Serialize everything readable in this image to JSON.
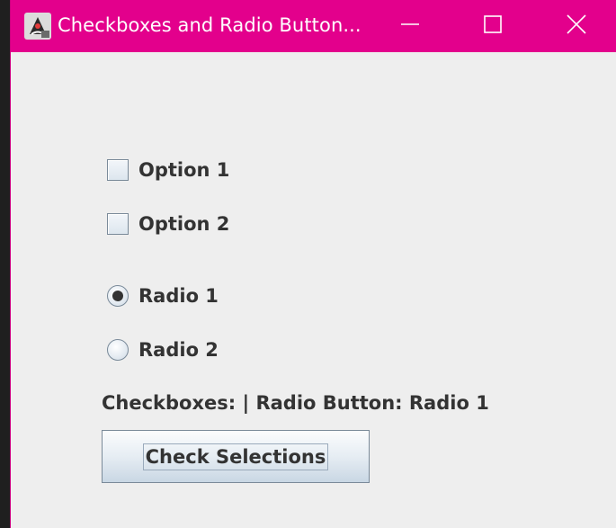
{
  "window": {
    "title": "Checkboxes and Radio Button...",
    "titlebar_color": "#e3008c",
    "app_icon": "java-duke-icon",
    "controls": {
      "minimize_icon": "minimize-icon",
      "maximize_icon": "maximize-icon",
      "close_icon": "close-icon"
    }
  },
  "checkboxes": [
    {
      "label": "Option 1",
      "checked": false
    },
    {
      "label": "Option 2",
      "checked": false
    }
  ],
  "radios": [
    {
      "label": "Radio 1",
      "selected": true
    },
    {
      "label": "Radio 2",
      "selected": false
    }
  ],
  "status": {
    "text": "Checkboxes: | Radio Button: Radio 1"
  },
  "actions": {
    "check_label": "Check Selections"
  }
}
